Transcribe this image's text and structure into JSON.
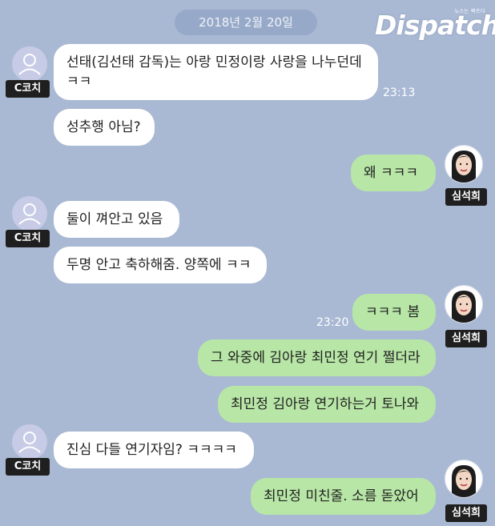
{
  "header": {
    "date": "2018년 2월 20일",
    "watermark_tagline": "뉴스는 팩트다",
    "watermark": "Dispatch"
  },
  "participants": {
    "coach": "C코치",
    "me": "심석희"
  },
  "messages": [
    {
      "id": 1,
      "from": "coach",
      "lines": [
        "선태(김선태 감독)는 아랑 민정이랑 사랑을 나누던데",
        "ㅋㅋ"
      ],
      "time": "23:13"
    },
    {
      "id": 2,
      "from": "coach",
      "lines": [
        "성추행 아님?"
      ]
    },
    {
      "id": 3,
      "from": "me",
      "lines": [
        "왜 ㅋㅋㅋ"
      ]
    },
    {
      "id": 4,
      "from": "coach",
      "lines": [
        "둘이 껴안고 있음"
      ]
    },
    {
      "id": 5,
      "from": "coach",
      "lines": [
        "두명 안고 축하해줌. 양쪽에 ㅋㅋ"
      ]
    },
    {
      "id": 6,
      "from": "me",
      "lines": [
        "ㅋㅋㅋ 봄"
      ],
      "time": "23:20"
    },
    {
      "id": 7,
      "from": "me",
      "lines": [
        "그 와중에 김아랑 최민정 연기 쩔더라"
      ]
    },
    {
      "id": 8,
      "from": "me",
      "lines": [
        "최민정 김아랑 연기하는거 토나와"
      ]
    },
    {
      "id": 9,
      "from": "coach",
      "lines": [
        "진심 다들 연기자임? ㅋㅋㅋㅋ"
      ]
    },
    {
      "id": 10,
      "from": "me",
      "lines": [
        "최민정 미친줄. 소름 돋았어"
      ]
    }
  ],
  "colors": {
    "background": "#a9b9d4",
    "bubble_incoming": "#ffffff",
    "bubble_outgoing": "#b7e6a6",
    "name_tag": "#1f1f1f"
  },
  "icons": {
    "coach_avatar": "default-person-icon",
    "me_avatar": "profile-photo"
  }
}
